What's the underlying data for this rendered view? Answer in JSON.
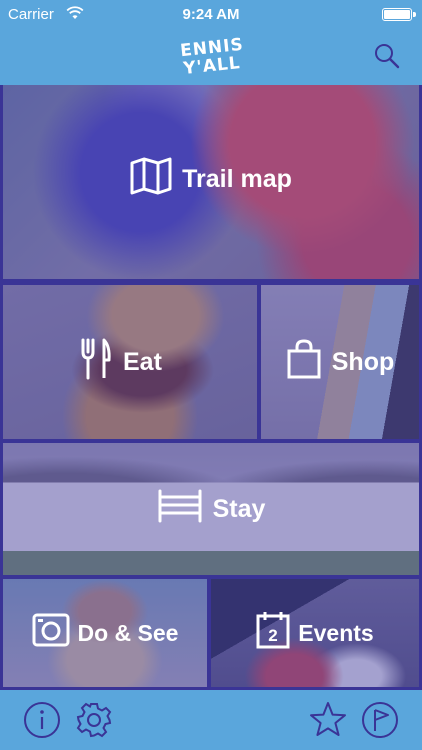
{
  "status_bar": {
    "carrier": "Carrier",
    "time": "9:24 AM"
  },
  "header": {
    "logo_line1": "ENNIS",
    "logo_line2": "Y'ALL",
    "search_icon": "search-icon"
  },
  "tiles": {
    "trail_map": {
      "label": "Trail map",
      "icon": "map-icon"
    },
    "eat": {
      "label": "Eat",
      "icon": "fork-knife-icon"
    },
    "shop": {
      "label": "Shop",
      "icon": "shopping-bag-icon"
    },
    "stay": {
      "label": "Stay",
      "icon": "bed-icon"
    },
    "do_see": {
      "label": "Do & See",
      "icon": "camera-icon"
    },
    "events": {
      "label": "Events",
      "icon": "calendar-icon",
      "calendar_day": "2"
    }
  },
  "tab_bar": {
    "items": [
      "info-icon",
      "gear-icon",
      "star-icon",
      "flag-icon"
    ]
  },
  "colors": {
    "accent": "#5aa6dc",
    "frame": "#3a3496",
    "icon_dark": "#3a3496"
  }
}
